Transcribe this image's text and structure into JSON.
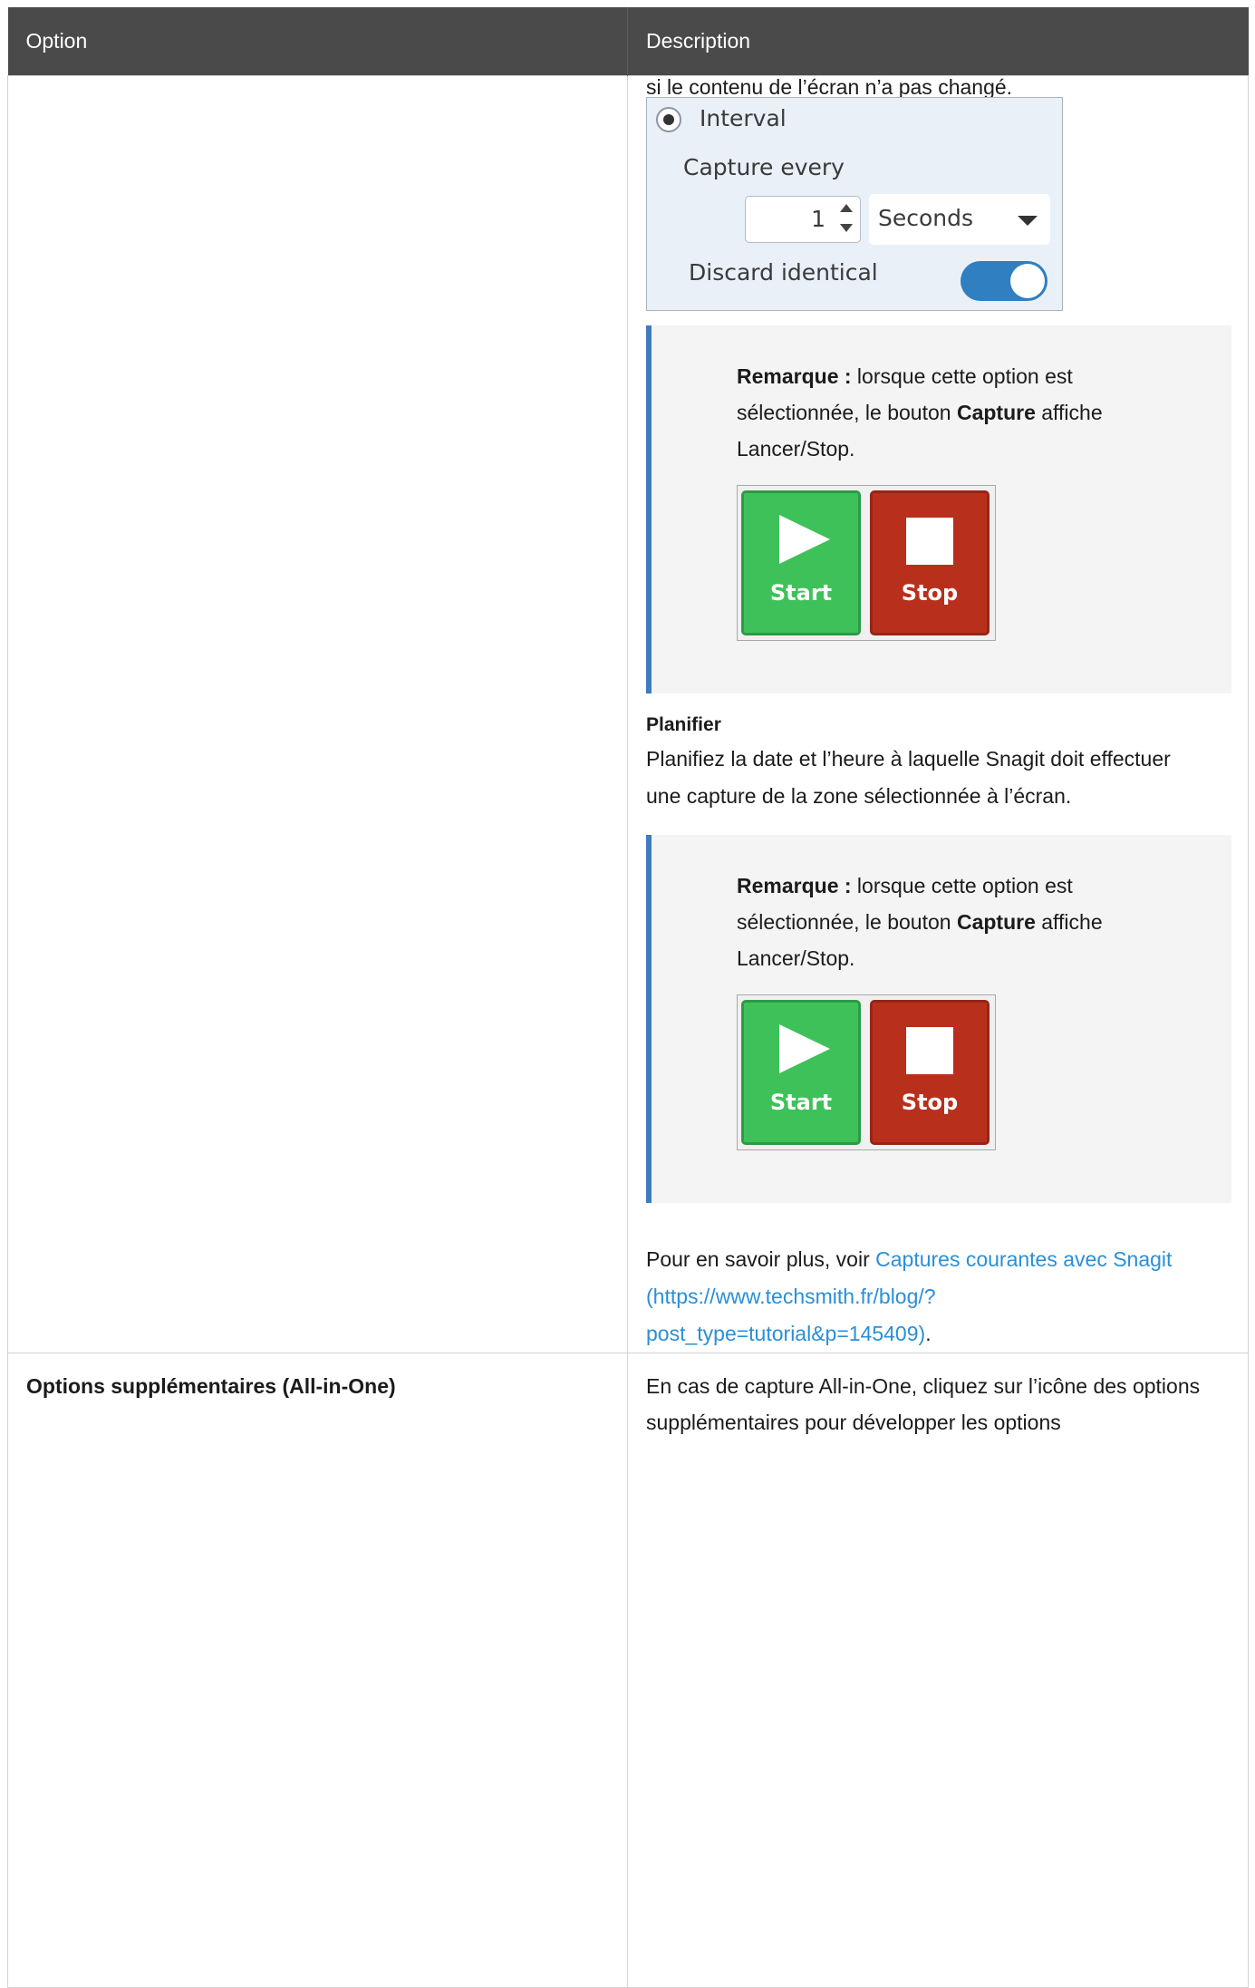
{
  "table": {
    "headers": [
      "Option",
      "Description"
    ]
  },
  "row1": {
    "top_text": "si le contenu de l’écran n’a pas changé.",
    "interval_panel": {
      "radio_label": "Interval",
      "capture_every_label": "Capture every",
      "spinner_value": "1",
      "unit_select": "Seconds",
      "discard_label": "Discard identical",
      "discard_toggle_on": true
    },
    "note1": {
      "bold_prefix": "Remarque :",
      "text_a": " lorsque cette option est sélectionnée, le bouton ",
      "bold_mid": "Capture",
      "text_b": " affiche Lancer/Stop.",
      "start_label": "Start",
      "stop_label": "Stop"
    },
    "planifier_heading": "Planifier",
    "planifier_text": "Planifiez la date et l’heure à laquelle Snagit doit effectuer une capture de la zone sélectionnée à l’écran.",
    "note2": {
      "bold_prefix": "Remarque :",
      "text_a": " lorsque cette option est sélectionnée, le bouton ",
      "bold_mid": "Capture",
      "text_b": " affiche Lancer/Stop.",
      "start_label": "Start",
      "stop_label": "Stop"
    },
    "more_prefix": "Pour en savoir plus, voir ",
    "more_link": "Captures courantes avec Snagit (https://www.techsmith.fr/blog/?post_type=tutorial&p=145409)",
    "more_suffix": "."
  },
  "row2": {
    "option": "Options supplémentaires (All-in-One)",
    "description": "En cas de capture All-in-One, cliquez sur l’icône des options supplémentaires pour développer les options"
  }
}
